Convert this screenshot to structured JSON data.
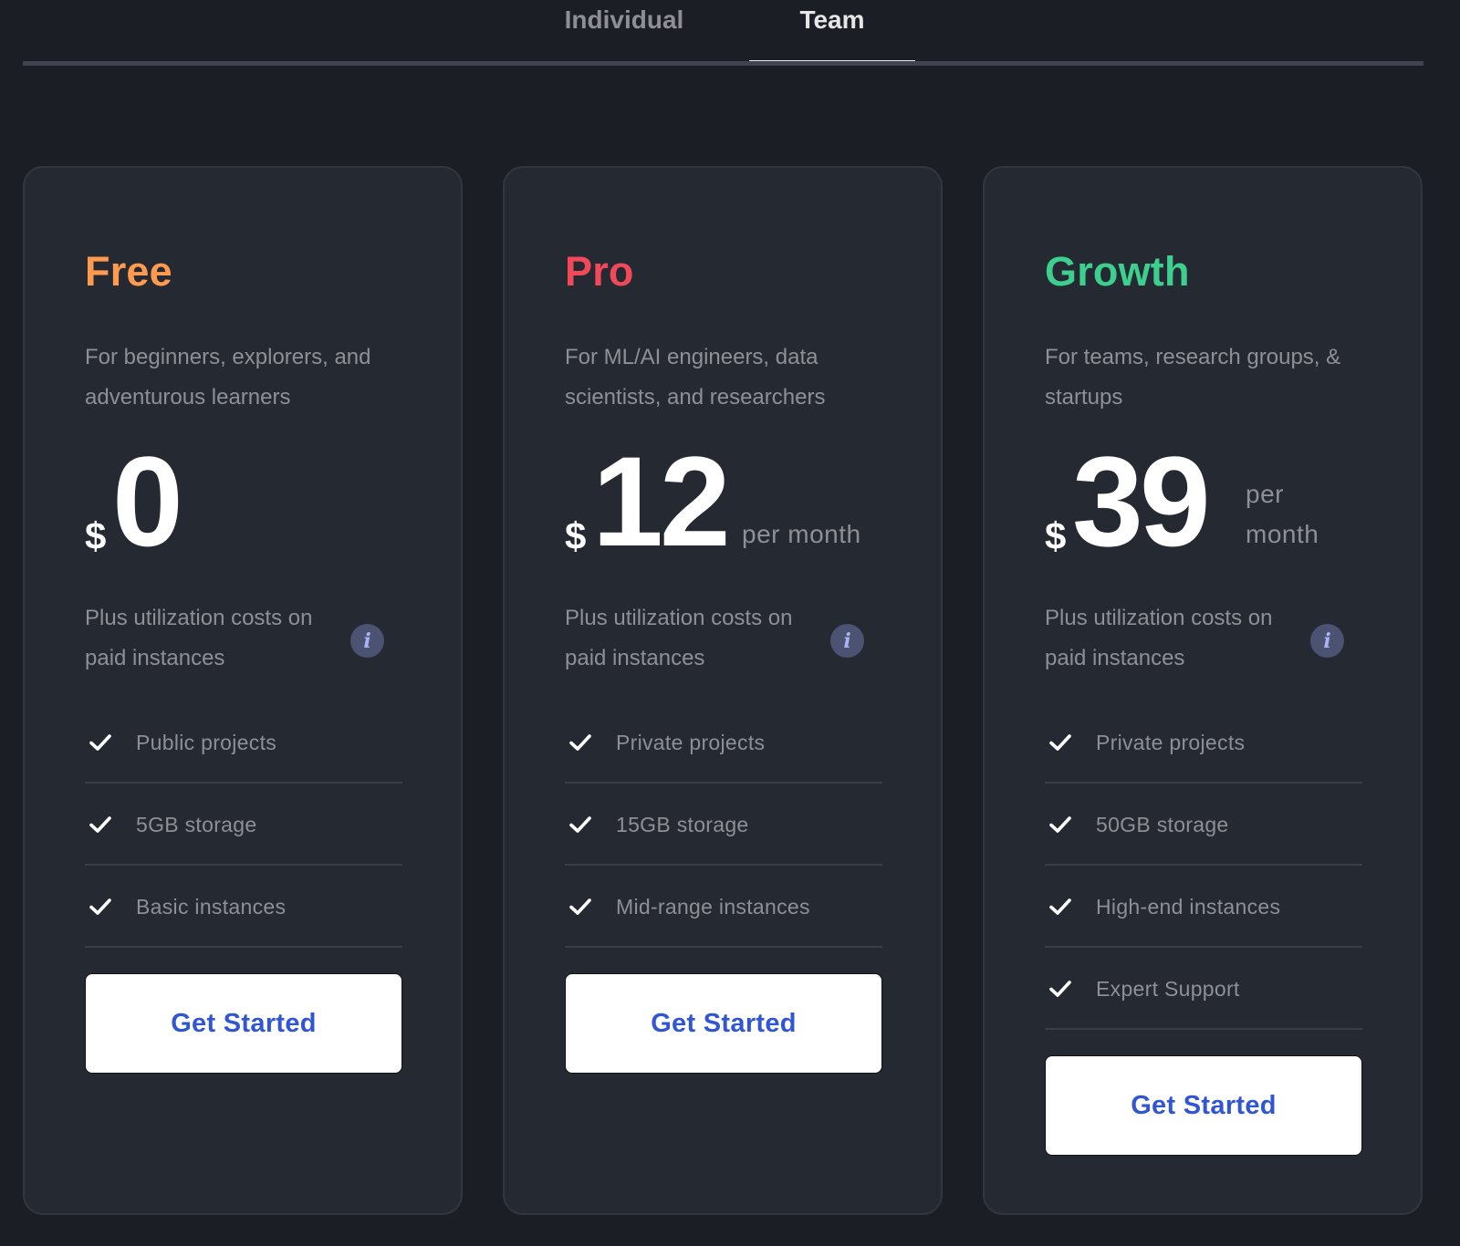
{
  "tabs": [
    {
      "label": "Individual",
      "active": false
    },
    {
      "label": "Team",
      "active": true
    }
  ],
  "colors": {
    "free": "#ff9a4f",
    "pro": "#f2495a",
    "growth": "#3ccf8e",
    "cta_text": "#3056d3"
  },
  "plans": [
    {
      "name": "Free",
      "color": "#ff9a4f",
      "description": "For beginners, explorers, and adventurous learners",
      "currency": "$",
      "amount": "0",
      "period": "",
      "utilization_note": "Plus utilization costs on paid instances",
      "info_icon": "info-icon",
      "features": [
        "Public projects",
        "5GB storage",
        "Basic instances"
      ],
      "cta_label": "Get Started"
    },
    {
      "name": "Pro",
      "color": "#f2495a",
      "description": "For ML/AI engineers, data scientists, and researchers",
      "currency": "$",
      "amount": "12",
      "period": "per month",
      "utilization_note": "Plus utilization costs on paid instances",
      "info_icon": "info-icon",
      "features": [
        "Private projects",
        "15GB storage",
        "Mid-range instances"
      ],
      "cta_label": "Get Started"
    },
    {
      "name": "Growth",
      "color": "#3ccf8e",
      "description": "For teams, research groups, & startups",
      "currency": "$",
      "amount": "39",
      "period": "per month",
      "utilization_note": "Plus utilization costs on paid instances",
      "info_icon": "info-icon",
      "features": [
        "Private projects",
        "50GB storage",
        "High-end instances",
        "Expert Support"
      ],
      "cta_label": "Get Started"
    }
  ]
}
